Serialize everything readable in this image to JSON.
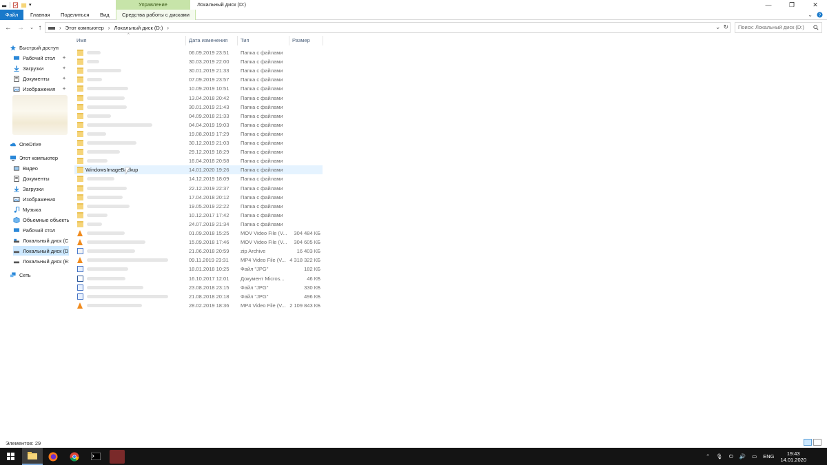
{
  "window": {
    "title": "Локальный диск (D:)",
    "manage_tab": "Управление",
    "controls": [
      "minimize",
      "restore",
      "close"
    ]
  },
  "ribbon": {
    "tabs": [
      "Файл",
      "Главная",
      "Поделиться",
      "Вид",
      "Средства работы с дисками"
    ]
  },
  "address": {
    "crumbs": [
      "Этот компьютер",
      "Локальный диск (D:)"
    ],
    "search_placeholder": "Поиск: Локальный диск (D:)"
  },
  "columns": {
    "name": "Имя",
    "date": "Дата изменения",
    "type": "Тип",
    "size": "Размер"
  },
  "nav": {
    "quick_access": "Быстрый доступ",
    "quick_items": [
      "Рабочий стол",
      "Загрузки",
      "Документы",
      "Изображения"
    ],
    "onedrive": "OneDrive",
    "this_pc": "Этот компьютер",
    "pc_items": [
      "Видео",
      "Документы",
      "Загрузки",
      "Изображения",
      "Музыка",
      "Объемные объекты",
      "Рабочий стол",
      "Локальный диск (C:)",
      "Локальный диск (D:)",
      "Локальный диск (E:)"
    ],
    "network": "Сеть"
  },
  "files": [
    {
      "name": "",
      "date": "06.09.2019 23:51",
      "type": "Папка с файлами",
      "size": "",
      "icon": "folder"
    },
    {
      "name": "",
      "date": "30.03.2019 22:00",
      "type": "Папка с файлами",
      "size": "",
      "icon": "folder"
    },
    {
      "name": "",
      "date": "30.01.2019 21:33",
      "type": "Папка с файлами",
      "size": "",
      "icon": "folder"
    },
    {
      "name": "",
      "date": "07.09.2019 23:57",
      "type": "Папка с файлами",
      "size": "",
      "icon": "folder"
    },
    {
      "name": "",
      "date": "10.09.2019 10:51",
      "type": "Папка с файлами",
      "size": "",
      "icon": "folder"
    },
    {
      "name": "",
      "date": "13.04.2018 20:42",
      "type": "Папка с файлами",
      "size": "",
      "icon": "folder"
    },
    {
      "name": "",
      "date": "30.01.2019 21:43",
      "type": "Папка с файлами",
      "size": "",
      "icon": "folder"
    },
    {
      "name": "",
      "date": "04.09.2018 21:33",
      "type": "Папка с файлами",
      "size": "",
      "icon": "folder"
    },
    {
      "name": "",
      "date": "04.04.2019 19:03",
      "type": "Папка с файлами",
      "size": "",
      "icon": "folder"
    },
    {
      "name": "",
      "date": "19.08.2019 17:29",
      "type": "Папка с файлами",
      "size": "",
      "icon": "folder"
    },
    {
      "name": "",
      "date": "30.12.2019 21:03",
      "type": "Папка с файлами",
      "size": "",
      "icon": "folder"
    },
    {
      "name": "",
      "date": "29.12.2019 18:29",
      "type": "Папка с файлами",
      "size": "",
      "icon": "folder"
    },
    {
      "name": "",
      "date": "16.04.2018 20:58",
      "type": "Папка с файлами",
      "size": "",
      "icon": "folder"
    },
    {
      "name": "WindowsImageBackup",
      "date": "14.01.2020 19:26",
      "type": "Папка с файлами",
      "size": "",
      "icon": "folder",
      "selected": true
    },
    {
      "name": "",
      "date": "14.12.2019 18:09",
      "type": "Папка с файлами",
      "size": "",
      "icon": "folder"
    },
    {
      "name": "",
      "date": "22.12.2019 22:37",
      "type": "Папка с файлами",
      "size": "",
      "icon": "folder"
    },
    {
      "name": "",
      "date": "17.04.2018 20:12",
      "type": "Папка с файлами",
      "size": "",
      "icon": "folder"
    },
    {
      "name": "",
      "date": "19.05.2019 22:22",
      "type": "Папка с файлами",
      "size": "",
      "icon": "folder"
    },
    {
      "name": "",
      "date": "10.12.2017 17:42",
      "type": "Папка с файлами",
      "size": "",
      "icon": "folder"
    },
    {
      "name": "",
      "date": "24.07.2019 21:34",
      "type": "Папка с файлами",
      "size": "",
      "icon": "folder"
    },
    {
      "name": "",
      "date": "01.09.2018 15:25",
      "type": "MOV Video File (V...",
      "size": "304 484 КБ",
      "icon": "vlc"
    },
    {
      "name": "",
      "date": "15.09.2018 17:46",
      "type": "MOV Video File (V...",
      "size": "304 605 КБ",
      "icon": "vlc"
    },
    {
      "name": "",
      "date": "21.06.2018 20:59",
      "type": "zip Archive",
      "size": "16 403 КБ",
      "icon": "zip"
    },
    {
      "name": "",
      "date": "09.11.2019 23:31",
      "type": "MP4 Video File (V...",
      "size": "4 318 322 КБ",
      "icon": "vlc"
    },
    {
      "name": "",
      "date": "18.01.2018 10:25",
      "type": "Файл \"JPG\"",
      "size": "182 КБ",
      "icon": "jpg"
    },
    {
      "name": "",
      "date": "16.10.2017 12:01",
      "type": "Документ Micros...",
      "size": "46 КБ",
      "icon": "doc"
    },
    {
      "name": "",
      "date": "23.08.2018 23:15",
      "type": "Файл \"JPG\"",
      "size": "330 КБ",
      "icon": "jpg"
    },
    {
      "name": "",
      "date": "21.08.2018 20:18",
      "type": "Файл \"JPG\"",
      "size": "496 КБ",
      "icon": "jpg"
    },
    {
      "name": "",
      "date": "28.02.2019 18:36",
      "type": "MP4 Video File (V...",
      "size": "2 109 843 КБ",
      "icon": "vlc"
    }
  ],
  "status": {
    "count": "Элементов: 29"
  },
  "taskbar": {
    "apps": [
      "start",
      "file-explorer",
      "firefox",
      "chrome",
      "terminal",
      "blurred-app"
    ],
    "lang": "ENG",
    "time": "19:43",
    "date": "14.01.2020"
  },
  "colors": {
    "accent": "#1979ca",
    "manage_tab": "#c7e4a9",
    "selection": "#e5f3ff",
    "nav_selection": "#cce8ff",
    "taskbar": "#141414"
  }
}
